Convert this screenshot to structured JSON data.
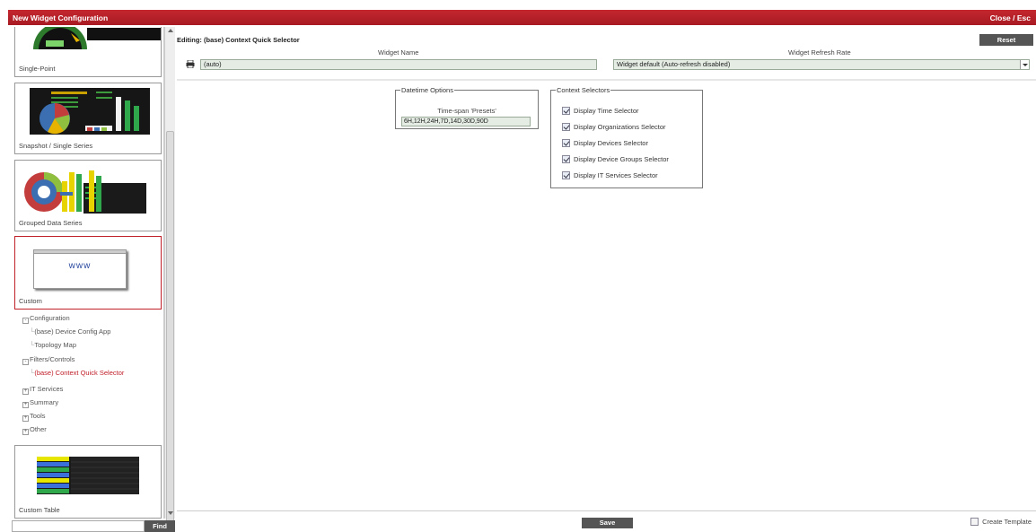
{
  "window": {
    "title": "New Widget Configuration",
    "close_label": "Close / Esc"
  },
  "sidebar": {
    "cards": [
      {
        "label": "Single-Point"
      },
      {
        "label": "Snapshot / Single Series"
      },
      {
        "label": "Grouped Data Series"
      },
      {
        "label": "Custom",
        "thumb_text": "www"
      },
      {
        "label": "Custom Table"
      }
    ],
    "tree": [
      {
        "label": "Configuration",
        "expander": "-"
      },
      {
        "label": "(base) Device Config App"
      },
      {
        "label": "Topology Map"
      },
      {
        "label": "Filters/Controls",
        "expander": "-"
      },
      {
        "label": "(base) Context Quick Selector"
      },
      {
        "label": "IT Services",
        "expander": "+"
      },
      {
        "label": "Summary",
        "expander": "+"
      },
      {
        "label": "Tools",
        "expander": "+"
      },
      {
        "label": "Other",
        "expander": "+"
      }
    ],
    "find_label": "Find"
  },
  "editor": {
    "title": "Editing: (base) Context Quick Selector",
    "reset_label": "Reset",
    "widget_name_header": "Widget Name",
    "widget_name_value": "(auto)",
    "refresh_header": "Widget Refresh Rate",
    "refresh_value": "Widget default (Auto-refresh disabled)",
    "datetime": {
      "legend": "Datetime Options",
      "timespan_label": "Time-span 'Presets'",
      "timespan_value": "6H,12H,24H,7D,14D,30D,90D"
    },
    "context": {
      "legend": "Context Selectors",
      "options": [
        {
          "label": "Display Time Selector",
          "checked": true
        },
        {
          "label": "Display Organizations Selector",
          "checked": true
        },
        {
          "label": "Display Devices Selector",
          "checked": true
        },
        {
          "label": "Display Device Groups Selector",
          "checked": true
        },
        {
          "label": "Display IT Services Selector",
          "checked": true
        }
      ]
    },
    "save_label": "Save",
    "create_template_label": "Create Template"
  },
  "colors": {
    "title_bar": "#b8222a",
    "selected": "#c0202a",
    "button": "#555555"
  }
}
